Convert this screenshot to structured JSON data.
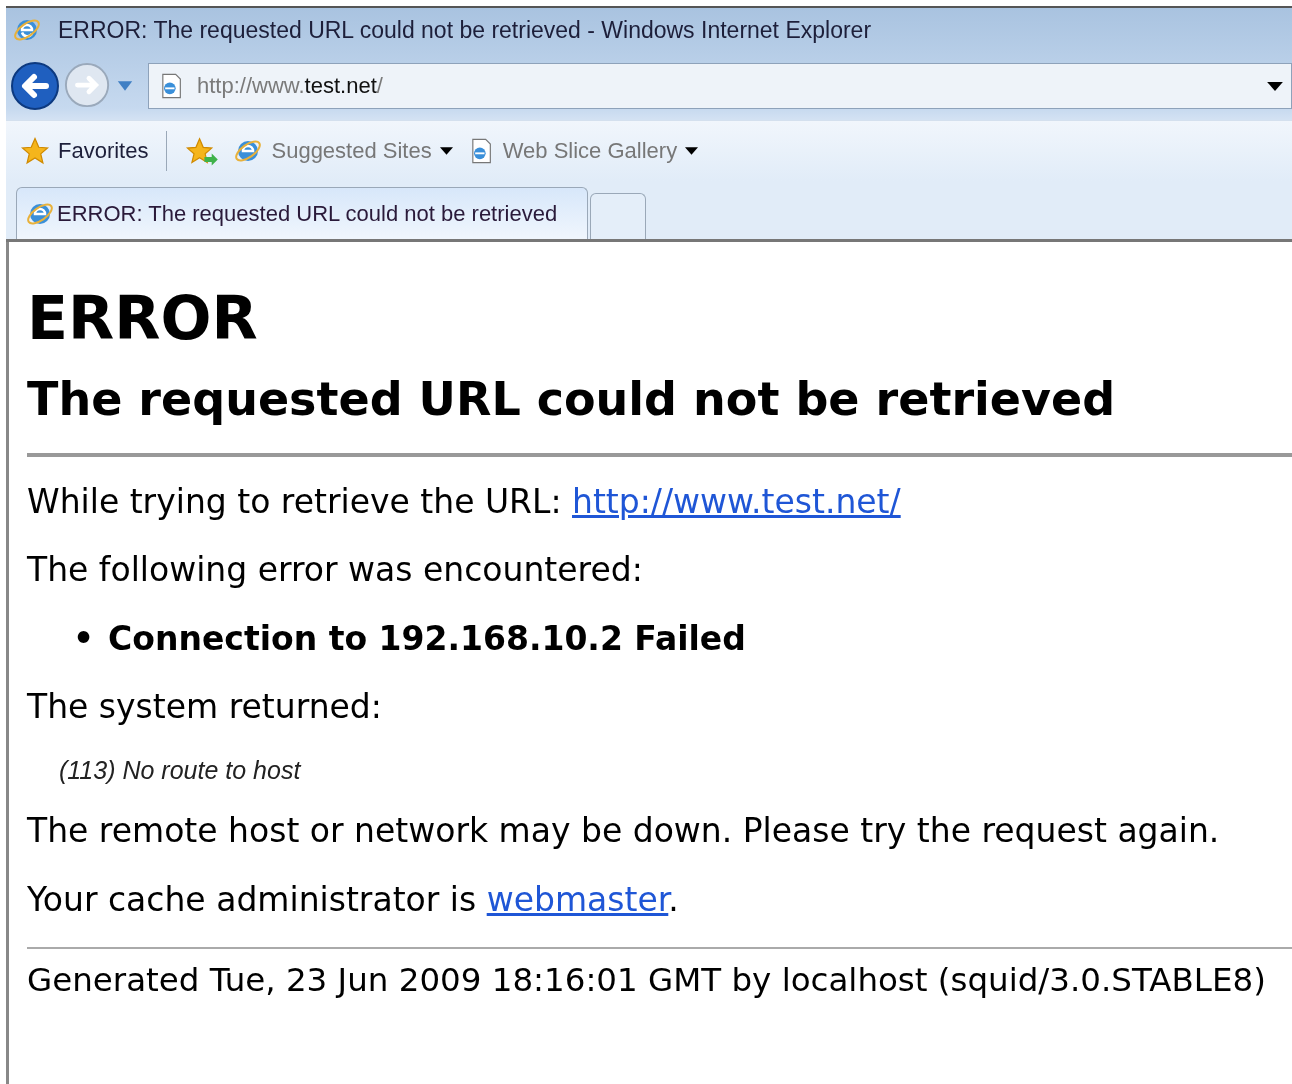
{
  "window": {
    "title": "ERROR: The requested URL could not be retrieved - Windows Internet Explorer"
  },
  "address_bar": {
    "scheme": "http://www.",
    "host": "test.net",
    "path": "/"
  },
  "favorites_bar": {
    "favorites": "Favorites",
    "links": [
      {
        "label": "Suggested Sites",
        "kind": "ie",
        "dropdown": true
      },
      {
        "label": "Web Slice Gallery",
        "kind": "page",
        "dropdown": true
      }
    ]
  },
  "tabs": [
    {
      "label": "ERROR: The requested URL could not be retrieved",
      "selected": true
    },
    {
      "selected": false
    }
  ],
  "page": {
    "heading": "ERROR",
    "subheading": "The requested URL could not be retrieved",
    "blocks": [
      {
        "kind": "para",
        "before": "While trying to retrieve the URL: ",
        "link": "http://www.test.net/"
      },
      {
        "kind": "para",
        "before": "The following error was encountered:"
      },
      {
        "kind": "bullet",
        "marker": "•",
        "text": "Connection to 192.168.10.2 Failed"
      },
      {
        "kind": "para",
        "before": "The system returned:"
      },
      {
        "kind": "note",
        "text": "(113) No route to host"
      },
      {
        "kind": "para",
        "before": "The remote host or network may be down. Please try the request again."
      },
      {
        "kind": "para",
        "before": "Your cache administrator is ",
        "link": "webmaster",
        "after": "."
      }
    ],
    "footer": "Generated Tue, 23 Jun 2009 18:16:01 GMT by localhost (squid/3.0.STABLE8)"
  }
}
